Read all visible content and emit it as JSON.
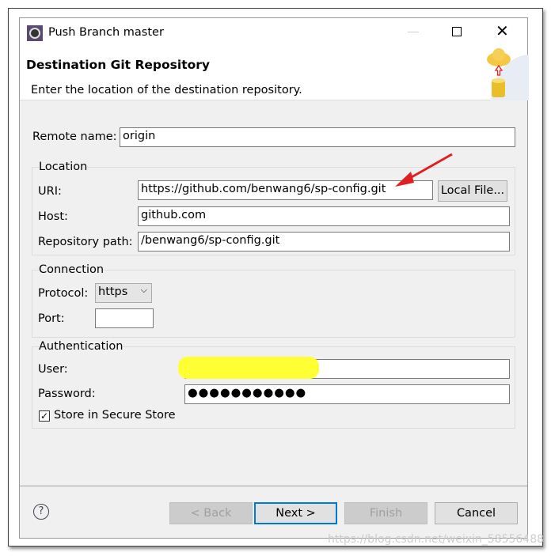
{
  "window": {
    "title": "Push Branch master"
  },
  "header": {
    "title": "Destination Git Repository",
    "description": "Enter the location of the destination repository."
  },
  "remote": {
    "label": "Remote name:",
    "value": "origin"
  },
  "location": {
    "title": "Location",
    "uri_label": "URI:",
    "uri_value": "https://github.com/benwang6/sp-config.git",
    "local_file": "Local File...",
    "host_label": "Host:",
    "host_value": "github.com",
    "path_label": "Repository path:",
    "path_value": "/benwang6/sp-config.git"
  },
  "connection": {
    "title": "Connection",
    "protocol_label": "Protocol:",
    "protocol_value": "https",
    "port_label": "Port:",
    "port_value": ""
  },
  "auth": {
    "title": "Authentication",
    "user_label": "User:",
    "password_label": "Password:",
    "password_value": "●●●●●●●●●●●",
    "store_label": "Store in Secure Store",
    "store_checked": true
  },
  "buttons": {
    "back": "< Back",
    "next": "Next >",
    "finish": "Finish",
    "cancel": "Cancel"
  },
  "watermark": "https://blog.csdn.net/weixin_58556488",
  "colors": {
    "accent": "#0078d7",
    "arrow": "#e02020",
    "redaction": "#ffff33"
  }
}
